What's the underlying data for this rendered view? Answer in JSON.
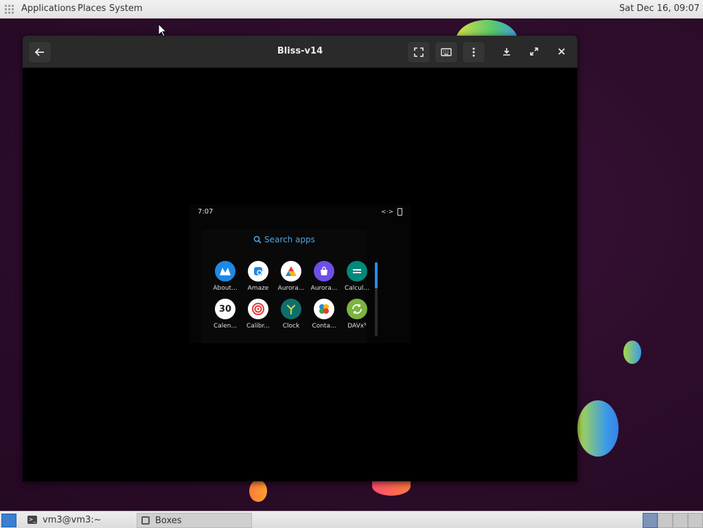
{
  "top_panel": {
    "menus": [
      "Applications",
      "Places",
      "System"
    ],
    "clock": "Sat Dec 16, 09:07"
  },
  "window": {
    "title": "Bliss-v14",
    "icons": {
      "back": "back-arrow-icon",
      "fullscreen": "fullscreen-icon",
      "keyboard": "keyboard-icon",
      "menu": "kebab-menu-icon",
      "download": "download-icon",
      "maximize": "maximize-icon",
      "close": "close-icon"
    }
  },
  "android": {
    "time": "7:07",
    "search_label": "Search apps",
    "apps": [
      {
        "label": "About...",
        "icon": "about-icon",
        "color": "#1e88e5"
      },
      {
        "label": "Amaze",
        "icon": "amaze-icon",
        "color": "#ffffff"
      },
      {
        "label": "Aurora...",
        "icon": "aurora-droid-icon",
        "color": "#ffffff"
      },
      {
        "label": "Aurora...",
        "icon": "aurora-store-icon",
        "color": "#6f4ee6"
      },
      {
        "label": "Calcul...",
        "icon": "calculator-icon",
        "color": "#ffffff"
      },
      {
        "label": "Calen...",
        "icon": "calendar-icon",
        "color": "#ffffff",
        "glyph": "30"
      },
      {
        "label": "Calibr...",
        "icon": "calibration-icon",
        "color": "#ffffff"
      },
      {
        "label": "Clock",
        "icon": "clock-icon",
        "color": "#0f6e6a"
      },
      {
        "label": "Conta...",
        "icon": "contacts-icon",
        "color": "#ffffff"
      },
      {
        "label": "DAVx⁵",
        "icon": "davx-icon",
        "color": "#7cb342"
      }
    ]
  },
  "taskbar": {
    "tasks": [
      {
        "label": "vm3@vm3:~",
        "icon": "terminal-icon"
      },
      {
        "label": "Boxes",
        "icon": "boxes-icon"
      }
    ]
  }
}
